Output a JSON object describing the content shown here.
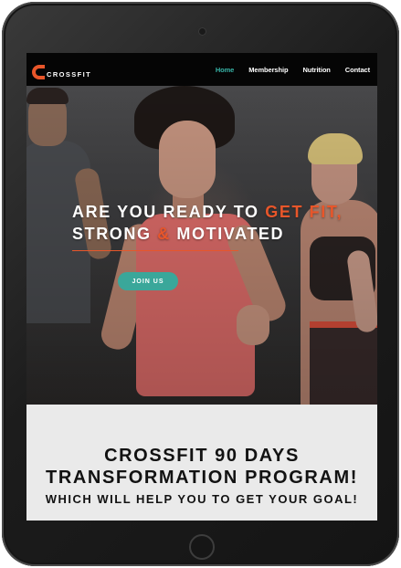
{
  "brand": {
    "name": "CROSSFIT",
    "accent_color": "#e8562a"
  },
  "nav": {
    "items": [
      {
        "label": "Home",
        "active": true
      },
      {
        "label": "Membership",
        "active": false
      },
      {
        "label": "Nutrition",
        "active": false
      },
      {
        "label": "Contact",
        "active": false
      }
    ],
    "active_color": "#37b3a6"
  },
  "hero": {
    "line1_prefix": "ARE YOU READY TO ",
    "line1_accent": "GET FIT,",
    "line2_part1": "STRONG ",
    "line2_amp": "&",
    "line2_part2": " MOTIVATED",
    "button_label": "JOIN US",
    "button_color": "#3aa79a"
  },
  "promo": {
    "title": "CROSSFIT 90 DAYS TRANSFORMATION PROGRAM!",
    "subtitle": "WHICH WILL HELP YOU TO GET YOUR GOAL!"
  }
}
